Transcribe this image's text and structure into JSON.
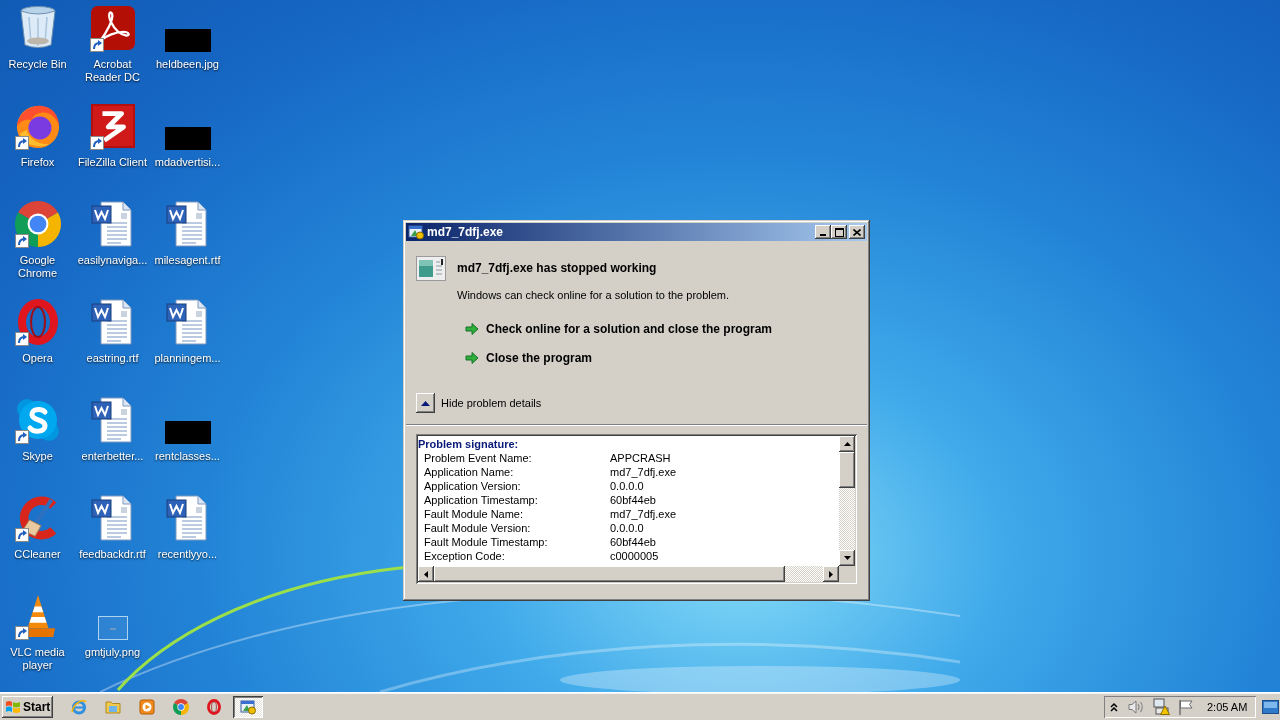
{
  "desktop": {
    "icons": [
      {
        "label": "Recycle Bin",
        "kind": "recycle-bin",
        "shortcut": false
      },
      {
        "label": "Firefox",
        "kind": "firefox",
        "shortcut": true
      },
      {
        "label": "Google Chrome",
        "kind": "chrome",
        "shortcut": true
      },
      {
        "label": "Opera",
        "kind": "opera",
        "shortcut": true
      },
      {
        "label": "Skype",
        "kind": "skype",
        "shortcut": true
      },
      {
        "label": "CCleaner",
        "kind": "ccleaner",
        "shortcut": true
      },
      {
        "label": "VLC media player",
        "kind": "vlc",
        "shortcut": true
      },
      {
        "label": "Acrobat Reader DC",
        "kind": "acrobat",
        "shortcut": true
      },
      {
        "label": "FileZilla Client",
        "kind": "filezilla",
        "shortcut": true
      },
      {
        "label": "easilynaviga...",
        "kind": "document",
        "shortcut": false
      },
      {
        "label": "eastring.rtf",
        "kind": "document",
        "shortcut": false
      },
      {
        "label": "enterbetter...",
        "kind": "document",
        "shortcut": false
      },
      {
        "label": "feedbackdr.rtf",
        "kind": "document",
        "shortcut": false
      },
      {
        "label": "gmtjuly.png",
        "kind": "image",
        "shortcut": false
      },
      {
        "label": "heldbeen.jpg",
        "kind": "hidden",
        "shortcut": false
      },
      {
        "label": "mdadvertisi...",
        "kind": "hidden",
        "shortcut": false
      },
      {
        "label": "milesagent.rtf",
        "kind": "document",
        "shortcut": false
      },
      {
        "label": "planningem...",
        "kind": "document",
        "shortcut": false
      },
      {
        "label": "rentclasses...",
        "kind": "hidden",
        "shortcut": false
      },
      {
        "label": "recentlyyo...",
        "kind": "document",
        "shortcut": false
      }
    ]
  },
  "dialog": {
    "title": "md7_7dfj.exe",
    "heading": "md7_7dfj.exe has stopped working",
    "message": "Windows can check online for a solution to the problem.",
    "actions": [
      {
        "label": "Check online for a solution and close the program"
      },
      {
        "label": "Close the program"
      }
    ],
    "details_toggle": {
      "label": "Hide problem details",
      "expanded": true
    },
    "details": {
      "heading": "Problem signature:",
      "rows": [
        {
          "name": "Problem Event Name:",
          "value": "APPCRASH"
        },
        {
          "name": "Application Name:",
          "value": "md7_7dfj.exe"
        },
        {
          "name": "Application Version:",
          "value": "0.0.0.0"
        },
        {
          "name": "Application Timestamp:",
          "value": "60bf44eb"
        },
        {
          "name": "Fault Module Name:",
          "value": "md7_7dfj.exe"
        },
        {
          "name": "Fault Module Version:",
          "value": "0.0.0.0"
        },
        {
          "name": "Fault Module Timestamp:",
          "value": "60bf44eb"
        },
        {
          "name": "Exception Code:",
          "value": "c0000005"
        }
      ]
    }
  },
  "taskbar": {
    "start": "Start",
    "quick_launch": [
      {
        "kind": "ie"
      },
      {
        "kind": "explorer"
      },
      {
        "kind": "media-player"
      },
      {
        "kind": "chrome"
      },
      {
        "kind": "opera"
      }
    ],
    "tasks": [
      {
        "kind": "crash-dialog",
        "selected": true
      }
    ],
    "tray": {
      "clock": "2:05 AM"
    }
  }
}
